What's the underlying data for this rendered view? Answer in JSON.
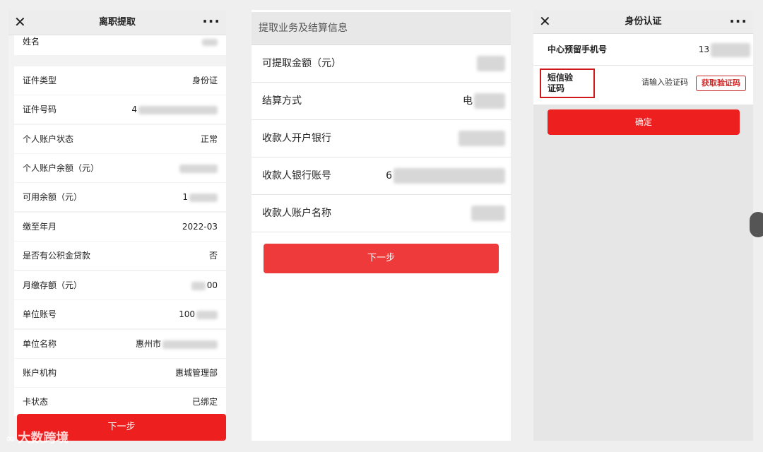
{
  "panel1": {
    "title": "离职提取",
    "rows": [
      {
        "label": "姓名",
        "value": ""
      },
      {
        "label": "证件类型",
        "value": "身份证"
      },
      {
        "label": "证件号码",
        "value": "4"
      },
      {
        "label": "个人账户状态",
        "value": "正常"
      },
      {
        "label": "个人账户余额（元）",
        "value": ""
      },
      {
        "label": "可用余额（元）",
        "value": "1"
      },
      {
        "label": "缴至年月",
        "value": "2022-03"
      },
      {
        "label": "是否有公积金贷款",
        "value": "否"
      },
      {
        "label": "月缴存额（元）",
        "value": "00"
      },
      {
        "label": "单位账号",
        "value": "100"
      },
      {
        "label": "单位名称",
        "value": "惠州市"
      },
      {
        "label": "账户机构",
        "value": "惠城管理部"
      },
      {
        "label": "卡状态",
        "value": "已绑定"
      }
    ],
    "next_button": "下一步"
  },
  "panel2": {
    "section_title": "提取业务及结算信息",
    "rows": [
      {
        "label": "可提取金额（元）",
        "value": ""
      },
      {
        "label": "结算方式",
        "value": "电"
      },
      {
        "label": "收款人开户银行",
        "value": ""
      },
      {
        "label": "收款人银行账号",
        "value": "6"
      },
      {
        "label": "收款人账户名称",
        "value": ""
      }
    ],
    "next_button": "下一步"
  },
  "panel3": {
    "title": "身份认证",
    "phone_label": "中心预留手机号",
    "phone_value": "13",
    "sms_label_line1": "短信验",
    "sms_label_line2": "证码",
    "sms_placeholder": "请输入验证码",
    "get_code_button": "获取验证码",
    "confirm_button": "确定"
  },
  "watermark": "大数跨境",
  "colors": {
    "accent_red": "#ee1f1f",
    "highlight_border": "#d01818"
  }
}
